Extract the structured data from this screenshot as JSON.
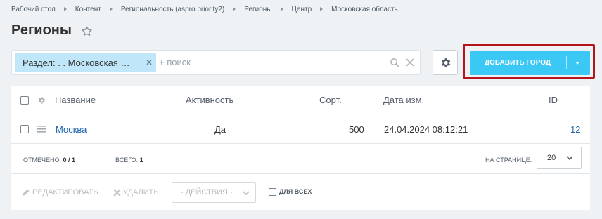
{
  "breadcrumb": [
    "Рабочий стол",
    "Контент",
    "Региональность (aspro.priority2)",
    "Регионы",
    "Центр",
    "Московская область"
  ],
  "page_title": "Регионы",
  "filter": {
    "chip": "Раздел: . . Московская …",
    "placeholder": "+ поиск"
  },
  "add_button": {
    "label": "ДОБАВИТЬ ГОРОД"
  },
  "table": {
    "columns": [
      "Название",
      "Активность",
      "Сорт.",
      "Дата изм.",
      "ID"
    ],
    "rows": [
      {
        "name": "Москва",
        "active": "Да",
        "sort": "500",
        "modified": "24.04.2024 08:12:21",
        "id": "12"
      }
    ]
  },
  "footer": {
    "selected_label": "ОТМЕЧЕНО:",
    "selected_value": "0 / 1",
    "total_label": "ВСЕГО:",
    "total_value": "1",
    "per_page_label": "НА СТРАНИЦЕ:",
    "per_page_value": "20"
  },
  "actions": {
    "edit": "РЕДАКТИРОВАТЬ",
    "delete": "УДАЛИТЬ",
    "select": "- ДЕЙСТВИЯ -",
    "for_all": "ДЛЯ ВСЕХ"
  },
  "colors": {
    "accent": "#3bc8f5",
    "highlight_frame": "#b3151b",
    "link": "#2067b0"
  }
}
